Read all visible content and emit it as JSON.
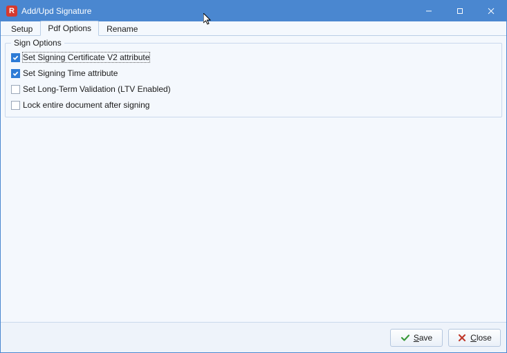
{
  "window": {
    "title": "Add/Upd Signature",
    "app_icon_letter": "R"
  },
  "tabs": {
    "items": [
      {
        "label": "Setup"
      },
      {
        "label": "Pdf Options"
      },
      {
        "label": "Rename"
      }
    ],
    "active_index": 1
  },
  "group": {
    "legend": "Sign Options",
    "options": [
      {
        "label": "Set Signing Certificate V2 attribute",
        "checked": true,
        "focused": true
      },
      {
        "label": "Set Signing Time attribute",
        "checked": true,
        "focused": false
      },
      {
        "label": "Set Long-Term Validation (LTV Enabled)",
        "checked": false,
        "focused": false
      },
      {
        "label": "Lock entire document after signing",
        "checked": false,
        "focused": false
      }
    ]
  },
  "footer": {
    "save_label": "Save",
    "close_label": "Close"
  }
}
